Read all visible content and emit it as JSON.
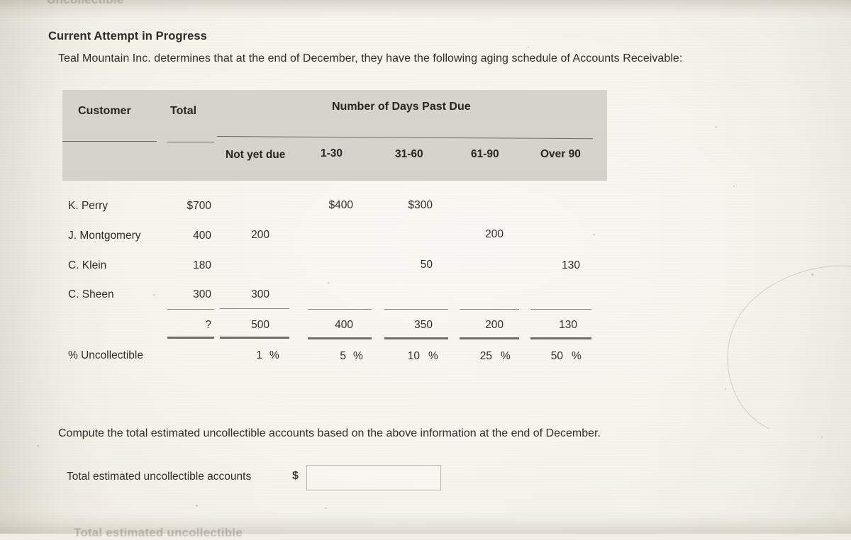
{
  "page": {
    "heading": "Current Attempt in Progress",
    "intro": "Teal Mountain Inc. determines that at the end of December, they have the following aging schedule of Accounts Receivable:",
    "clipped_top_text": "Uncollectible",
    "clipped_bottom_text": "Total estimated uncollectible",
    "compute_instruction": "Compute the total estimated uncollectible accounts based on the above information at the end of December.",
    "background_color": "#f2eee5",
    "header_band_color": "#d3d2cb"
  },
  "table": {
    "header": {
      "customer": "Customer",
      "total": "Total",
      "days_group": "Number of Days Past Due"
    },
    "aging_buckets": [
      "Not yet due",
      "1-30",
      "31-60",
      "61-90",
      "Over 90"
    ],
    "rows": [
      {
        "customer": "K. Perry",
        "total": "$700",
        "not_yet_due": "",
        "d1_30": "$400",
        "d31_60": "$300",
        "d61_90": "",
        "over_90": ""
      },
      {
        "customer": "J. Montgomery",
        "total": "400",
        "not_yet_due": "200",
        "d1_30": "",
        "d31_60": "",
        "d61_90": "200",
        "over_90": ""
      },
      {
        "customer": "C. Klein",
        "total": "180",
        "not_yet_due": "",
        "d1_30": "",
        "d31_60": "50",
        "d61_90": "",
        "over_90": "130"
      },
      {
        "customer": "C. Sheen",
        "total": "300",
        "not_yet_due": "300",
        "d1_30": "",
        "d31_60": "",
        "d61_90": "",
        "over_90": ""
      }
    ],
    "totals": {
      "total": "?",
      "not_yet_due": "500",
      "d1_30": "400",
      "d31_60": "350",
      "d61_90": "200",
      "over_90": "130"
    },
    "pct_row": {
      "label": "% Uncollectible",
      "total": "",
      "not_yet_due": "1",
      "d1_30": "5",
      "d31_60": "10",
      "d61_90": "25",
      "over_90": "50",
      "sign": "%"
    }
  },
  "answer": {
    "label": "Total estimated uncollectible accounts",
    "currency_symbol": "$",
    "value": "",
    "placeholder": ""
  }
}
